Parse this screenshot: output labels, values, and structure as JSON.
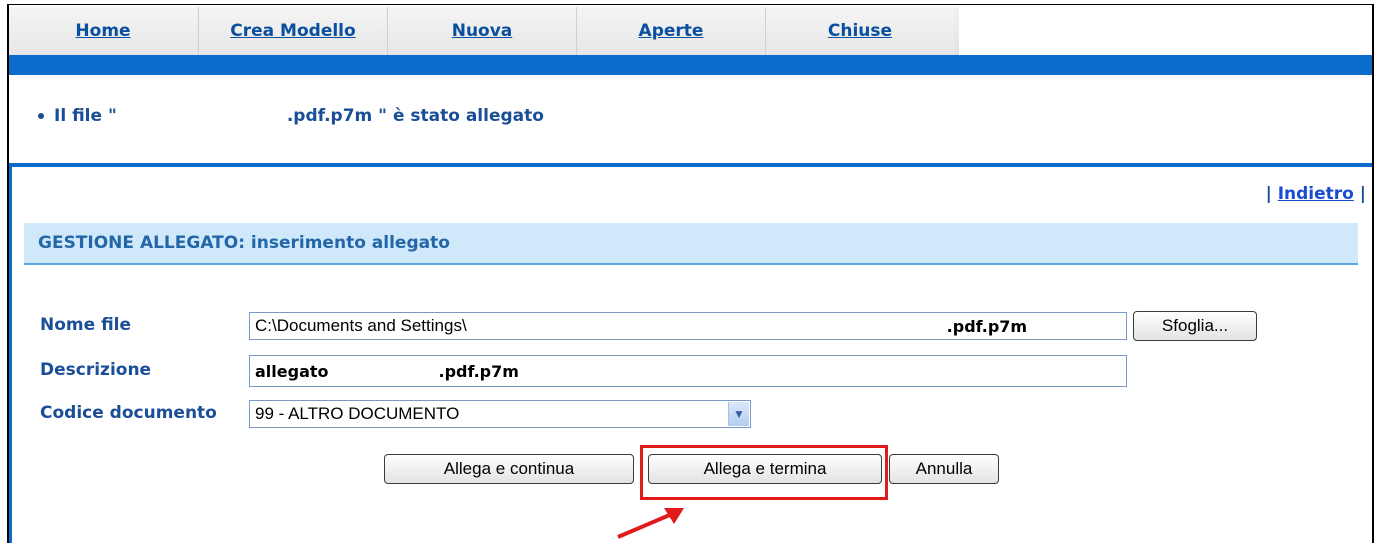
{
  "nav": {
    "tabs": [
      {
        "label": "Home"
      },
      {
        "label": "Crea Modello"
      },
      {
        "label": "Nuova"
      },
      {
        "label": "Aperte"
      },
      {
        "label": "Chiuse"
      }
    ]
  },
  "notice": {
    "text_prefix": "Il file \"",
    "text_suffix": ".pdf.p7m \" è stato allegato"
  },
  "back": {
    "left_sep": "|",
    "link_label": "Indietro",
    "right_sep": "|"
  },
  "section": {
    "title": "GESTIONE ALLEGATO: inserimento allegato"
  },
  "form": {
    "nome_file_label": "Nome file",
    "nome_file_value_start": "C:\\Documents and Settings\\",
    "nome_file_value_end": ".pdf.p7m",
    "browse_label": "Sfoglia...",
    "descrizione_label": "Descrizione",
    "descrizione_value_start": "allegato",
    "descrizione_value_end": ".pdf.p7m",
    "codice_label": "Codice documento",
    "codice_selected": "99 - ALTRO DOCUMENTO"
  },
  "actions": {
    "continue_label": "Allega e continua",
    "finish_label": "Allega e termina",
    "cancel_label": "Annulla"
  },
  "colors": {
    "accent_blue": "#0c6ccc",
    "label_blue": "#1a4f97",
    "highlight_red": "#e11a1a"
  }
}
